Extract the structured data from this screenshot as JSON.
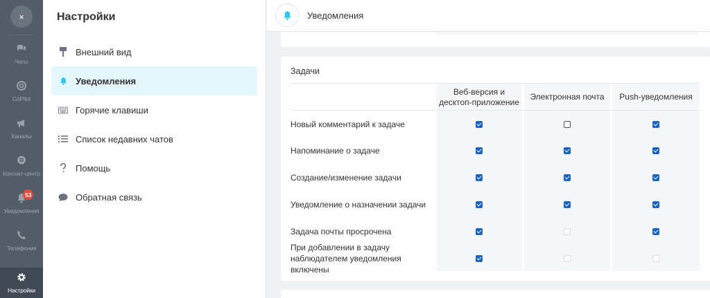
{
  "rail": {
    "items": [
      {
        "label": "Чаты",
        "icon": "chat-icon"
      },
      {
        "label": "CoPilot",
        "icon": "copilot-icon"
      },
      {
        "label": "Каналы",
        "icon": "megaphone-icon"
      },
      {
        "label": "Контакт-центр",
        "icon": "contact-center-icon"
      },
      {
        "label": "Уведомления",
        "icon": "bell-icon",
        "badge": "53"
      },
      {
        "label": "Телефония",
        "icon": "phone-icon"
      },
      {
        "label": "Настройки",
        "icon": "gear-icon",
        "active": true
      }
    ],
    "close_icon": "×"
  },
  "menu": {
    "title": "Настройки",
    "items": [
      {
        "label": "Внешний вид",
        "icon": "appearance-icon"
      },
      {
        "label": "Уведомления",
        "icon": "bell-icon",
        "active": true
      },
      {
        "label": "Горячие клавиши",
        "icon": "keyboard-icon"
      },
      {
        "label": "Список недавних чатов",
        "icon": "list-icon"
      },
      {
        "label": "Помощь",
        "icon": "question-icon"
      },
      {
        "label": "Обратная связь",
        "icon": "feedback-icon"
      }
    ]
  },
  "header": {
    "title": "Уведомления",
    "icon": "bell-icon"
  },
  "tasks": {
    "title": "Задачи",
    "columns": [
      "Веб-версия и десктоп-приложение",
      "Электронная почта",
      "Push-уведомления"
    ],
    "rows": [
      {
        "label": "Новый комментарий к задаче",
        "states": [
          "checked",
          "unchecked",
          "checked"
        ]
      },
      {
        "label": "Напоминание о задаче",
        "states": [
          "checked",
          "checked",
          "checked"
        ]
      },
      {
        "label": "Создание/изменение задачи",
        "states": [
          "checked",
          "checked",
          "checked"
        ]
      },
      {
        "label": "Уведомление о назначении задачи",
        "states": [
          "checked",
          "checked",
          "checked"
        ]
      },
      {
        "label": "Задача почты просрочена",
        "states": [
          "checked",
          "disabled",
          "checked"
        ]
      },
      {
        "label": "При добавлении в задачу наблюдателем уведомления включены",
        "states": [
          "checked",
          "disabled",
          "disabled"
        ]
      }
    ]
  },
  "colors": {
    "rail_bg": "#535c69",
    "accent": "#2fc6f6",
    "checkbox": "#1864c4",
    "badge": "#e24a3b",
    "active_menu_bg": "#e5f6fd"
  }
}
